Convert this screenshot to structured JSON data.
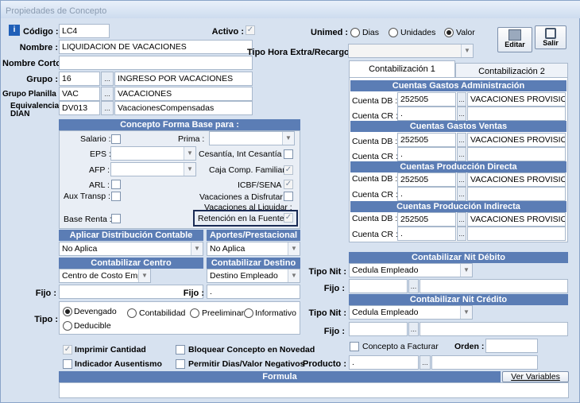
{
  "window": {
    "title": "Propiedades de Concepto"
  },
  "toolbar": {
    "edit_label": "Editar",
    "exit_label": "Salir"
  },
  "header": {
    "codigo_label": "Código :",
    "codigo": "LC4",
    "activo_label": "Activo :",
    "activo_checked": "✓",
    "nombre_label": "Nombre :",
    "nombre": "LIQUIDACION DE VACACIONES",
    "nombre_corto_label": "Nombre Corto :",
    "nombre_corto": "",
    "grupo_label": "Grupo :",
    "grupo_code": "16",
    "grupo_name": "INGRESO POR VACACIONES",
    "grupo_planilla_label": "Grupo Planilla :",
    "grupo_planilla_code": "VAC",
    "grupo_planilla_name": "VACACIONES",
    "equivalencia_label_1": "Equivalencia :",
    "equivalencia_label_2": "DIAN",
    "equivalencia_code": "DV013",
    "equivalencia_name": "VacacionesCompensadas",
    "dots": "...",
    "unimed_label": "Unimed :",
    "unimed_options": [
      "Dias",
      "Unidades",
      "Valor"
    ],
    "unimed_selected": "Valor",
    "tipo_hora_label": "Tipo Hora Extra/Recargo :",
    "tipo_hora_value": ""
  },
  "concepto_base": {
    "title": "Concepto Forma Base para :",
    "salario": "Salario :",
    "prima": "Prima :",
    "eps": "EPS :",
    "cesantia": "Cesantía, Int Cesantía :",
    "afp": "AFP :",
    "caja": "Caja Comp. Familiar :",
    "arl": "ARL :",
    "icbf": "ICBF/SENA :",
    "aux": "Aux Transp :",
    "vac_disfrutar": "Vacaciones a Disfrutar :",
    "vac_liquidar": "Vacaciones al Liquidar :",
    "base_renta": "Base Renta :",
    "retencion": "Retención en la Fuente :",
    "check": "✓"
  },
  "distribucion": {
    "title": "Aplicar Distribución Contable",
    "value": "No Aplica",
    "aportes_title": "Aportes/Prestacional",
    "aportes_value": "No Aplica"
  },
  "centro": {
    "title": "Contabilizar Centro",
    "value": "Centro de Costo Emple",
    "destino_title": "Contabilizar Destino",
    "destino_value": "Destino Empleado",
    "fijo_label": "Fijo :",
    "fijo2_label": "Fijo :",
    "fijo2_value": "."
  },
  "tipo": {
    "label": "Tipo :",
    "options": [
      "Devengado",
      "Contabilidad",
      "Preeliminar",
      "Informativo",
      "Deducible"
    ],
    "selected": "Devengado"
  },
  "flags": {
    "imprimir": "Imprimir Cantidad",
    "bloquear": "Bloquear Concepto en Novedad",
    "ausentismo": "Indicador Ausentismo",
    "permitir": "Permitir Dias/Valor Negativos"
  },
  "formula": {
    "title": "Formula",
    "ver_variables": "Ver Variables",
    "value": ""
  },
  "tabs": [
    "Contabilización 1",
    "Contabilización 2"
  ],
  "cuentas": [
    {
      "title": "Cuentas Gastos Administración",
      "db_label": "Cuenta DB :",
      "db_code": "252505",
      "db_name": "VACACIONES PROVISION",
      "cr_label": "Cuenta CR :",
      "cr_code": ".",
      "cr_name": ""
    },
    {
      "title": "Cuentas Gastos Ventas",
      "db_label": "Cuenta DB :",
      "db_code": "252505",
      "db_name": "VACACIONES PROVISION",
      "cr_label": "Cuenta CR :",
      "cr_code": ".",
      "cr_name": ""
    },
    {
      "title": "Cuentas Producción Directa",
      "db_label": "Cuenta DB :",
      "db_code": "252505",
      "db_name": "VACACIONES PROVISION",
      "cr_label": "Cuenta CR :",
      "cr_code": ".",
      "cr_name": ""
    },
    {
      "title": "Cuentas Producción Indirecta",
      "db_label": "Cuenta DB :",
      "db_code": "252505",
      "db_name": "VACACIONES PROVISION",
      "cr_label": "Cuenta CR :",
      "cr_code": ".",
      "cr_name": ""
    }
  ],
  "nit_debito": {
    "title": "Contabilizar Nit Débito",
    "tipo_label": "Tipo Nit :",
    "tipo_value": "Cedula Empleado",
    "fijo_label": "Fijo :"
  },
  "nit_credito": {
    "title": "Contabilizar Nit Crédito",
    "tipo_label": "Tipo Nit :",
    "tipo_value": "Cedula Empleado",
    "fijo_label": "Fijo :"
  },
  "extras": {
    "concepto_facturar": "Concepto a Facturar",
    "orden_label": "Orden :",
    "producto_label": "Producto :",
    "producto_value": "."
  }
}
